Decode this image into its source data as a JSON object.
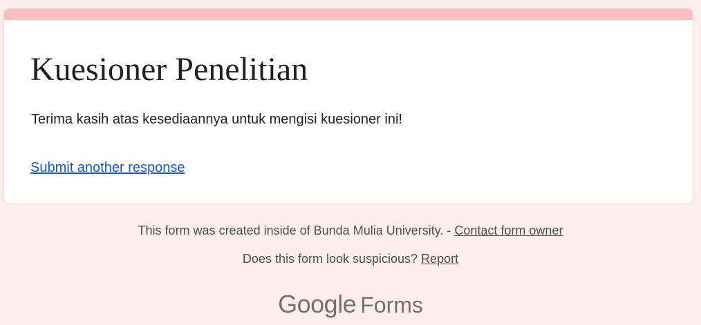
{
  "form": {
    "title": "Kuesioner Penelitian",
    "confirmation_message": "Terima kasih atas kesediaannya untuk mengisi kuesioner ini!",
    "submit_another_label": "Submit another response"
  },
  "footer": {
    "created_text": "This form was created inside of Bunda Mulia University. - ",
    "contact_label": "Contact form owner",
    "suspicious_text": "Does this form look suspicious? ",
    "report_label": "Report"
  },
  "branding": {
    "google": "Google",
    "forms": "Forms"
  },
  "colors": {
    "background": "#fdeeed",
    "accent": "#ffbfbc",
    "link": "#1a55c7",
    "text": "#202124"
  }
}
